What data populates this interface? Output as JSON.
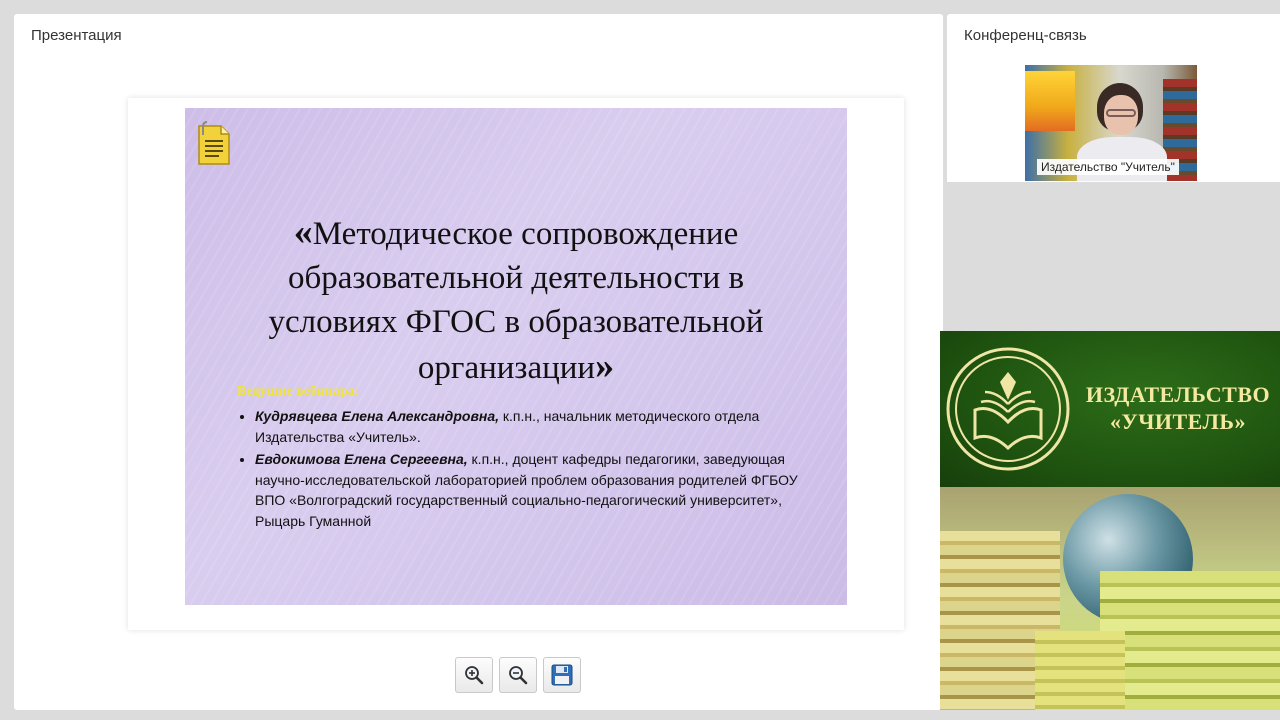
{
  "presentation": {
    "title": "Презентация",
    "slide": {
      "title_open_quote": "«",
      "title_text": "Методическое сопровождение образовательной деятельности в условиях ФГОС в образовательной организации",
      "title_close_quote": "»",
      "hosts_label": "Ведущие вебинара:",
      "hosts": [
        {
          "name": "Кудрявцева Елена Александровна,",
          "details": " к.п.н., начальник методического отдела Издательства «Учитель»."
        },
        {
          "name": "Евдокимова Елена Сергеевна,",
          "details": " к.п.н., доцент кафедры педагогики, заведующая научно-исследовательской лабораторией проблем образования родителей ФГБОУ ВПО «Волгоградский государственный социально-педагогический университет», Рыцарь Гуманной"
        }
      ]
    },
    "toolbar": {
      "zoom_in_icon": "zoom-in-icon",
      "zoom_out_icon": "zoom-out-icon",
      "save_icon": "save-icon"
    }
  },
  "conference": {
    "title": "Конференц-связь",
    "video_caption": "Издательство \"Учитель\""
  },
  "publisher_banner": {
    "line1": "ИЗДАТЕЛЬСТВО",
    "line2": "«УЧИТЕЛЬ»"
  },
  "colors": {
    "slide_bg": "#d3c6ec",
    "hosts_label": "#f0e43a",
    "publisher_green": "#1f5410",
    "publisher_text": "#f3e9a0"
  }
}
